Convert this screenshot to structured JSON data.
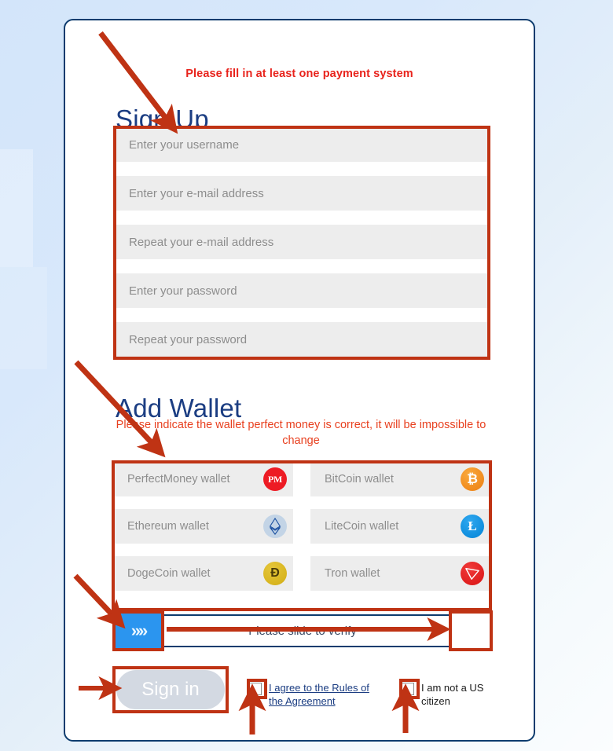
{
  "page": {
    "warning_top": "Please fill in at least one payment system",
    "signup_heading": "Sign Up",
    "addwallet_heading": "Add Wallet",
    "wallet_warning": "Please indicate the wallet perfect money is correct, it will be impossible to change"
  },
  "signup_fields": [
    {
      "name": "username",
      "placeholder": "Enter your username",
      "value": ""
    },
    {
      "name": "email",
      "placeholder": "Enter your e-mail address",
      "value": ""
    },
    {
      "name": "email_repeat",
      "placeholder": "Repeat your e-mail address",
      "value": ""
    },
    {
      "name": "password",
      "placeholder": "Enter your password",
      "value": ""
    },
    {
      "name": "password_repeat",
      "placeholder": "Repeat your password",
      "value": ""
    }
  ],
  "wallet_fields": [
    {
      "name": "perfectmoney",
      "placeholder": "PerfectMoney wallet",
      "value": "",
      "icon": "perfectmoney-icon",
      "glyph": "PM"
    },
    {
      "name": "bitcoin",
      "placeholder": "BitCoin wallet",
      "value": "",
      "icon": "bitcoin-icon",
      "glyph": "₿"
    },
    {
      "name": "ethereum",
      "placeholder": "Ethereum wallet",
      "value": "",
      "icon": "ethereum-icon",
      "glyph": ""
    },
    {
      "name": "litecoin",
      "placeholder": "LiteCoin wallet",
      "value": "",
      "icon": "litecoin-icon",
      "glyph": "Ł"
    },
    {
      "name": "dogecoin",
      "placeholder": "DogeCoin wallet",
      "value": "",
      "icon": "dogecoin-icon",
      "glyph": "Ð"
    },
    {
      "name": "tron",
      "placeholder": "Tron wallet",
      "value": "",
      "icon": "tron-icon",
      "glyph": ""
    }
  ],
  "slider": {
    "text": "Please slide to verify",
    "handle_icon": "double-chevron-right-icon",
    "handle_glyph": "»»"
  },
  "bottom": {
    "signin_label": "Sign in",
    "agree_label": "I agree to the Rules of the Agreement",
    "us_citizen_label": "I am not a US citizen"
  },
  "colors": {
    "accent_red": "#bf3314",
    "warning_red": "#e8231c",
    "wallet_warning_red": "#e8401f",
    "heading_blue": "#1b3d82",
    "card_border": "#0d3c6e",
    "slider_handle": "#2b95ef",
    "field_bg": "#ededed",
    "signin_bg": "#d3d9e2"
  }
}
